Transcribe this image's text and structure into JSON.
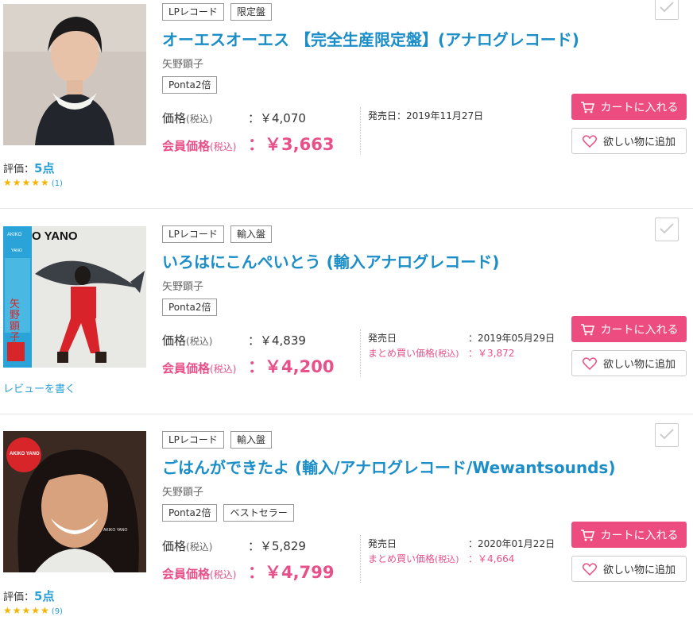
{
  "products": [
    {
      "tags": [
        "LPレコード",
        "限定盤"
      ],
      "title": "オーエスオーエス 【完全生産限定盤】(アナログレコード)",
      "artist": "矢野顕子",
      "promo_tags": [
        "Ponta2倍"
      ],
      "price_label": "価格",
      "tax_label": "(税込)",
      "price": "：￥4,070",
      "member_price_label": "会員価格",
      "member_price": "：￥3,663",
      "release_label": "発売日",
      "release_date": "：2019年11月27日",
      "rating_label": "評価：",
      "rating_score": "5点",
      "stars": "★★★★★",
      "review_count": "(1)",
      "cart_label": "カートに入れる",
      "wish_label": "欲しい物に追加"
    },
    {
      "tags": [
        "LPレコード",
        "輸入盤"
      ],
      "title": "いろはにこんぺいとう (輸入アナログレコード)",
      "artist": "矢野顕子",
      "promo_tags": [
        "Ponta2倍"
      ],
      "price_label": "価格",
      "tax_label": "(税込)",
      "price": "：￥4,839",
      "member_price_label": "会員価格",
      "member_price": "：￥4,200",
      "release_label": "発売日",
      "release_date": "：2019年05月29日",
      "matome_label": "まとめ買い価格",
      "matome_tax": "(税込)",
      "matome_price": "：￥3,872",
      "review_link": "レビューを書く",
      "cart_label": "カートに入れる",
      "wish_label": "欲しい物に追加"
    },
    {
      "tags": [
        "LPレコード",
        "輸入盤"
      ],
      "title": "ごはんができたよ (輸入/アナログレコード/Wewantsounds)",
      "artist": "矢野顕子",
      "promo_tags": [
        "Ponta2倍",
        "ベストセラー"
      ],
      "price_label": "価格",
      "tax_label": "(税込)",
      "price": "：￥5,829",
      "member_price_label": "会員価格",
      "member_price": "：￥4,799",
      "release_label": "発売日",
      "release_date": "：2020年01月22日",
      "matome_label": "まとめ買い価格",
      "matome_tax": "(税込)",
      "matome_price": "：￥4,664",
      "rating_label": "評価：",
      "rating_score": "5点",
      "stars": "★★★★★",
      "review_count": "(9)",
      "cart_label": "カートに入れる",
      "wish_label": "欲しい物に追加"
    }
  ],
  "cover_texts": {
    "p2_banner": "O YANO",
    "p2_side_top": "AKIKO",
    "p2_side_mid": "YANO",
    "p2_side_kanji": "矢野顕子",
    "p3_badge_top": "AKIKO YANO",
    "p3_caption": "AKIKO YANO"
  },
  "colors": {
    "accent_blue": "#1b8ec8",
    "accent_pink": "#ec4c80",
    "star": "#f4b400"
  },
  "icons": [
    "cart-icon",
    "heart-icon",
    "check-icon",
    "star-icon"
  ]
}
